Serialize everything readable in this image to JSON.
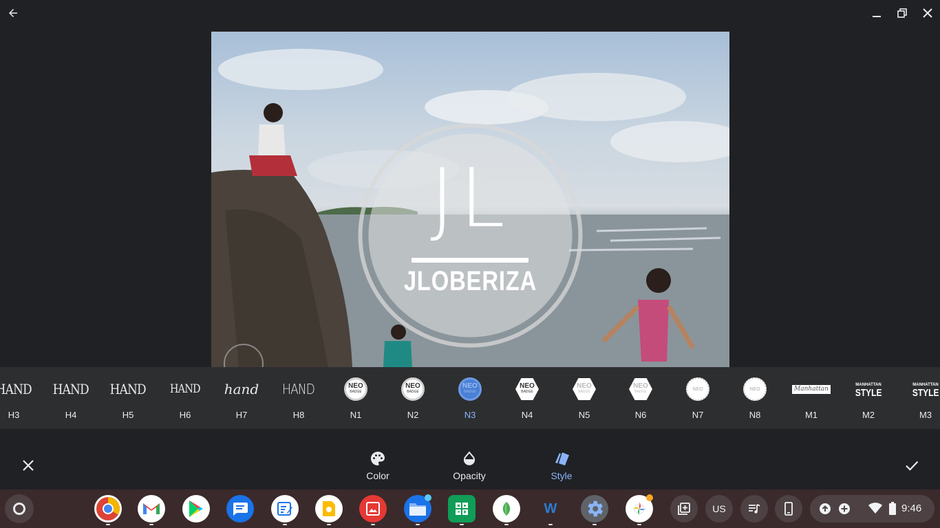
{
  "titlebar": {
    "back_icon": "arrow-back-icon",
    "minimize_icon": "minimize-icon",
    "restore_icon": "restore-icon",
    "close_icon": "close-icon"
  },
  "watermark": {
    "initials": "JL",
    "name": "JLOBERIZA"
  },
  "styles": [
    {
      "label": "H3",
      "thumb": "HAND"
    },
    {
      "label": "H4",
      "thumb": "HAND"
    },
    {
      "label": "H5",
      "thumb": "HAND"
    },
    {
      "label": "H6",
      "thumb": "HAND"
    },
    {
      "label": "H7",
      "thumb": "hand"
    },
    {
      "label": "H8",
      "thumb": "HAND"
    },
    {
      "label": "N1",
      "thumb": "NEO"
    },
    {
      "label": "N2",
      "thumb": "NEO"
    },
    {
      "label": "N3",
      "thumb": "NEO"
    },
    {
      "label": "N4",
      "thumb": "NEO"
    },
    {
      "label": "N5",
      "thumb": "NEO"
    },
    {
      "label": "N6",
      "thumb": "NEO"
    },
    {
      "label": "N7",
      "thumb": "NEO"
    },
    {
      "label": "N8",
      "thumb": "NEO"
    },
    {
      "label": "M1",
      "thumb": "Manhattan"
    },
    {
      "label": "M2",
      "thumb": "STYLE"
    },
    {
      "label": "M3",
      "thumb": "STYLE"
    }
  ],
  "badge_small_text": "BADGE",
  "manhattan_small": "MANHATTAN",
  "selected_style": "N3",
  "toolbar": {
    "cancel_icon": "close-icon",
    "confirm_icon": "check-icon",
    "tabs": [
      {
        "label": "Color",
        "icon": "palette-icon"
      },
      {
        "label": "Opacity",
        "icon": "opacity-icon"
      },
      {
        "label": "Style",
        "icon": "style-icon"
      }
    ],
    "active_tab": "Style"
  },
  "shelf": {
    "apps": [
      "Chrome",
      "Gmail",
      "Play Store",
      "Messages",
      "Docs Edit",
      "Keep",
      "Gallery",
      "Files",
      "Sheets",
      "Snapseed",
      "Word",
      "Settings",
      "Photos"
    ],
    "pods": [
      "clipboard-icon",
      "US",
      "media-icon",
      "phone-hub-icon"
    ],
    "time": "9:46"
  },
  "colors": {
    "accent": "#8ab4f8",
    "background": "#202124",
    "strip": "#2d2e30",
    "shelf": "#3b2a2b"
  }
}
